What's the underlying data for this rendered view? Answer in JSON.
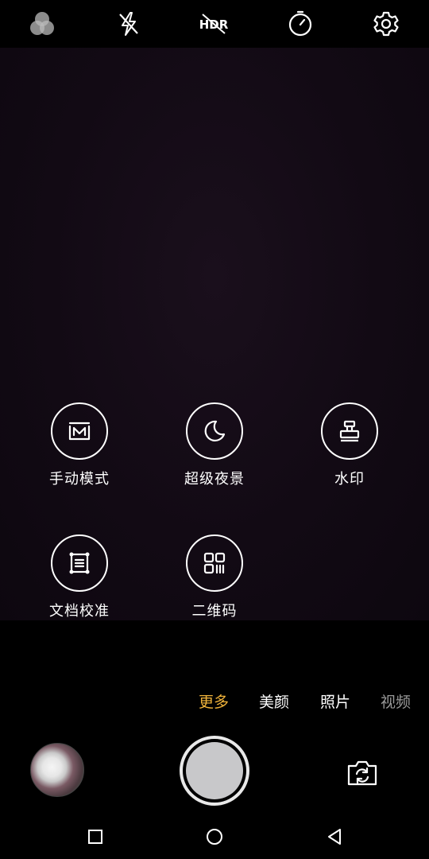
{
  "top_toolbar": {
    "icons": [
      "filter-icon",
      "flash-off-icon",
      "hdr-off-icon",
      "timer-icon",
      "settings-icon"
    ],
    "hdr_text": "HDR"
  },
  "modes": [
    {
      "label": "手动模式",
      "icon": "manual-mode-icon"
    },
    {
      "label": "超级夜景",
      "icon": "night-moon-icon"
    },
    {
      "label": "水印",
      "icon": "watermark-stamp-icon"
    },
    {
      "label": "文档校准",
      "icon": "document-correction-icon"
    },
    {
      "label": "二维码",
      "icon": "qr-code-icon"
    }
  ],
  "mode_tabs": {
    "items": [
      "更多",
      "美颜",
      "照片",
      "视频"
    ],
    "selected": "更多",
    "selected_color": "#f0b33a",
    "normal_color": "#ffffff",
    "faded_color": "#9a9a9a"
  },
  "controls": {
    "gallery_thumbnail": "gallery-thumbnail",
    "shutter": "shutter-button",
    "switch_camera": "switch-camera-icon"
  },
  "system_nav": [
    "recent-apps-icon",
    "home-icon",
    "back-icon"
  ]
}
